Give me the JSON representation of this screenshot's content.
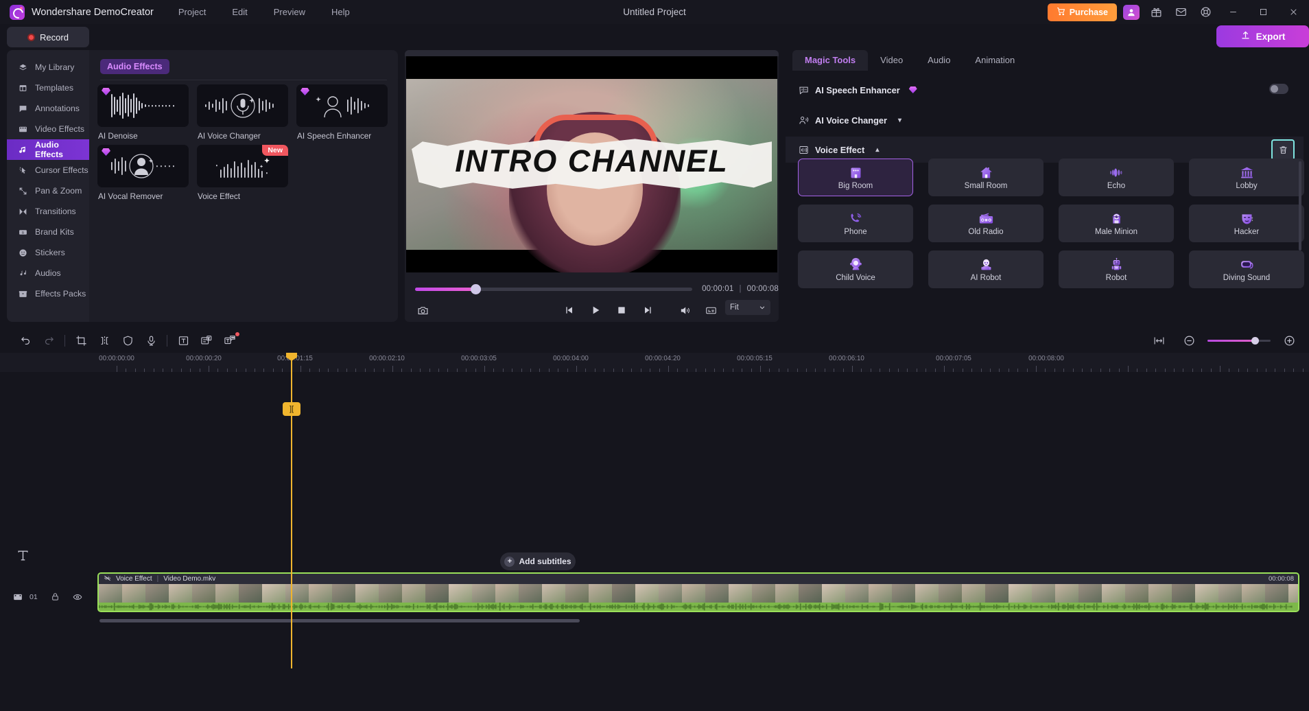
{
  "titlebar": {
    "app_name": "Wondershare DemoCreator",
    "menus": [
      "Project",
      "Edit",
      "Preview",
      "Help"
    ],
    "project_title": "Untitled Project",
    "purchase_label": "Purchase",
    "icons": [
      "user-icon",
      "gift-icon",
      "mail-icon",
      "support-icon"
    ],
    "window_buttons": [
      "minimize",
      "maximize",
      "close"
    ]
  },
  "actionbar": {
    "record_label": "Record",
    "export_label": "Export"
  },
  "sidebar": {
    "items": [
      {
        "label": "My Library",
        "icon": "layers-icon",
        "active": false
      },
      {
        "label": "Templates",
        "icon": "template-icon",
        "active": false
      },
      {
        "label": "Annotations",
        "icon": "annotation-icon",
        "active": false
      },
      {
        "label": "Video Effects",
        "icon": "film-icon",
        "active": false
      },
      {
        "label": "Audio Effects",
        "icon": "audio-note-icon",
        "active": true
      },
      {
        "label": "Cursor Effects",
        "icon": "cursor-icon",
        "active": false
      },
      {
        "label": "Pan & Zoom",
        "icon": "pan-zoom-icon",
        "active": false
      },
      {
        "label": "Transitions",
        "icon": "transition-icon",
        "active": false
      },
      {
        "label": "Brand Kits",
        "icon": "brand-icon",
        "active": false
      },
      {
        "label": "Stickers",
        "icon": "smiley-icon",
        "active": false
      },
      {
        "label": "Audios",
        "icon": "music-icon",
        "active": false
      },
      {
        "label": "Effects Packs",
        "icon": "package-icon",
        "active": false
      }
    ]
  },
  "effects_panel": {
    "title": "Audio Effects",
    "cards": [
      {
        "label": "AI Denoise",
        "premium": true,
        "new": false,
        "icon": "waveform-icon"
      },
      {
        "label": "AI Voice Changer",
        "premium": false,
        "new": false,
        "icon": "mic-circle-icon"
      },
      {
        "label": "AI Speech Enhancer",
        "premium": true,
        "new": false,
        "icon": "person-wave-icon"
      },
      {
        "label": "AI Vocal Remover",
        "premium": true,
        "new": false,
        "icon": "person-circle-wave-icon"
      },
      {
        "label": "Voice Effect",
        "premium": false,
        "new": true,
        "new_label": "New",
        "icon": "bars-sparkle-icon"
      }
    ]
  },
  "preview": {
    "overlay_text": "INTRO CHANNEL",
    "current_time": "00:00:01",
    "total_time": "00:00:08",
    "separator": "|",
    "controls": [
      "snapshot-icon",
      "prev-frame-icon",
      "play-icon",
      "stop-icon",
      "next-frame-icon",
      "volume-icon",
      "marker-icon",
      "no-effect-icon",
      "fullscreen-icon"
    ],
    "fit_label": "Fit"
  },
  "right_panel": {
    "tabs": [
      {
        "label": "Magic Tools",
        "active": true
      },
      {
        "label": "Video",
        "active": false
      },
      {
        "label": "Audio",
        "active": false
      },
      {
        "label": "Animation",
        "active": false
      }
    ],
    "rows": [
      {
        "label": "AI Speech Enhancer",
        "icon": "speech-enhancer-icon",
        "premium": true,
        "toggle": true,
        "toggle_on": false,
        "chevron": ""
      },
      {
        "label": "AI Voice Changer",
        "icon": "voice-changer-icon",
        "premium": false,
        "toggle": false,
        "chevron": "▾"
      },
      {
        "label": "Voice Effect",
        "icon": "voice-effect-icon",
        "premium": false,
        "toggle": false,
        "chevron": "▴",
        "delete_button": "trash-icon",
        "delete_highlighted": true
      }
    ],
    "voice_effects": [
      {
        "label": "Big Room",
        "icon": "building-icon",
        "selected": true
      },
      {
        "label": "Small Room",
        "icon": "house-icon",
        "selected": false
      },
      {
        "label": "Echo",
        "icon": "echo-waves-icon",
        "selected": false
      },
      {
        "label": "Lobby",
        "icon": "bank-columns-icon",
        "selected": false
      },
      {
        "label": "Phone",
        "icon": "phone-ring-icon",
        "selected": false
      },
      {
        "label": "Old Radio",
        "icon": "radio-icon",
        "selected": false
      },
      {
        "label": "Male Minion",
        "icon": "minion-icon",
        "selected": false
      },
      {
        "label": "Hacker",
        "icon": "mask-icon",
        "selected": false
      },
      {
        "label": "Child Voice",
        "icon": "child-icon",
        "selected": false
      },
      {
        "label": "AI Robot",
        "icon": "ai-robot-icon",
        "selected": false
      },
      {
        "label": "Robot",
        "icon": "robot-icon",
        "selected": false
      },
      {
        "label": "Diving Sound",
        "icon": "diving-mask-icon",
        "selected": false
      }
    ],
    "accent_color": "#a663e8",
    "highlight_color": "#7fe5e0"
  },
  "timeline": {
    "toolbar_icons": [
      "undo-icon",
      "redo-icon",
      "crop-icon",
      "split-icon",
      "shield-icon",
      "mic-icon",
      "text-icon",
      "subtitle-icon",
      "caption-icon"
    ],
    "zoom_controls": [
      "fit-timeline-icon",
      "zoom-out-icon",
      "zoom-slider",
      "zoom-in-icon"
    ],
    "ruler_labels": [
      "00:00:00:00",
      "00:00:00:20",
      "00:00:01:15",
      "00:00:02:10",
      "00:00:03:05",
      "00:00:04:00",
      "00:00:04:20",
      "00:00:05:15",
      "00:00:06:10",
      "00:00:07:05",
      "00:00:08:00"
    ],
    "playhead_time": "00:00:01:15",
    "playhead_badge": "][",
    "add_subtitles_label": "Add subtitles",
    "track": {
      "number": "01",
      "effect_label": "Voice Effect",
      "separator": "|",
      "clip_name": "Video Demo.mkv",
      "clip_duration": "00:00:08",
      "controls": [
        "lock-icon",
        "eye-icon",
        "mute-icon"
      ]
    }
  }
}
